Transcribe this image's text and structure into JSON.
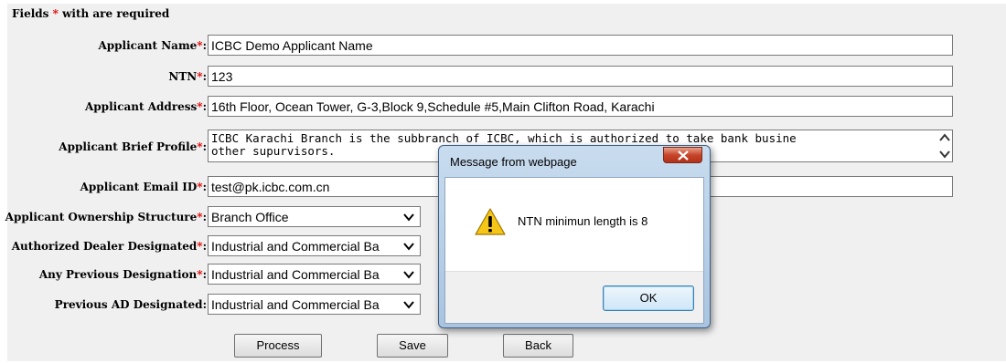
{
  "form": {
    "required_note_prefix": "Fields ",
    "required_star": "*",
    "required_note_suffix": " with are required",
    "required_marker": "*",
    "colon": ":",
    "fields": {
      "applicant_name": {
        "label": "Applicant Name",
        "value": "ICBC Demo Applicant Name"
      },
      "ntn": {
        "label": "NTN",
        "value": "123"
      },
      "applicant_address": {
        "label": "Applicant Address",
        "value": "16th Floor, Ocean Tower, G-3,Block 9,Schedule #5,Main Clifton Road, Karachi"
      },
      "brief_profile": {
        "label": "Applicant Brief Profile",
        "line1": "ICBC Karachi Branch is the subbranch of ICBC, which is authorized to take bank busine",
        "line2": "other supurvisors."
      },
      "email": {
        "label": "Applicant Email ID",
        "value": "test@pk.icbc.com.cn"
      },
      "ownership": {
        "label": "Applicant Ownership Structure",
        "value": "Branch Office"
      },
      "authorized_dealer": {
        "label": "Authorized Dealer Designated",
        "value": "Industrial and Commercial Ba"
      },
      "previous_designation": {
        "label": "Any Previous Designation",
        "value": "Industrial and Commercial Ba"
      },
      "previous_ad": {
        "label": "Previous AD Designated",
        "value": "Industrial and Commercial Ba"
      }
    },
    "buttons": {
      "process": "Process",
      "save": "Save",
      "back": "Back"
    }
  },
  "dialog": {
    "title": "Message from webpage",
    "message": "NTN minimun length is 8",
    "ok_label": "OK",
    "icon": "warning-icon"
  },
  "colors": {
    "required_star": "#e00000",
    "panel_bg": "#f0f0f0",
    "dialog_frame": "#b9d1ea",
    "close_button": "#c7442a"
  }
}
